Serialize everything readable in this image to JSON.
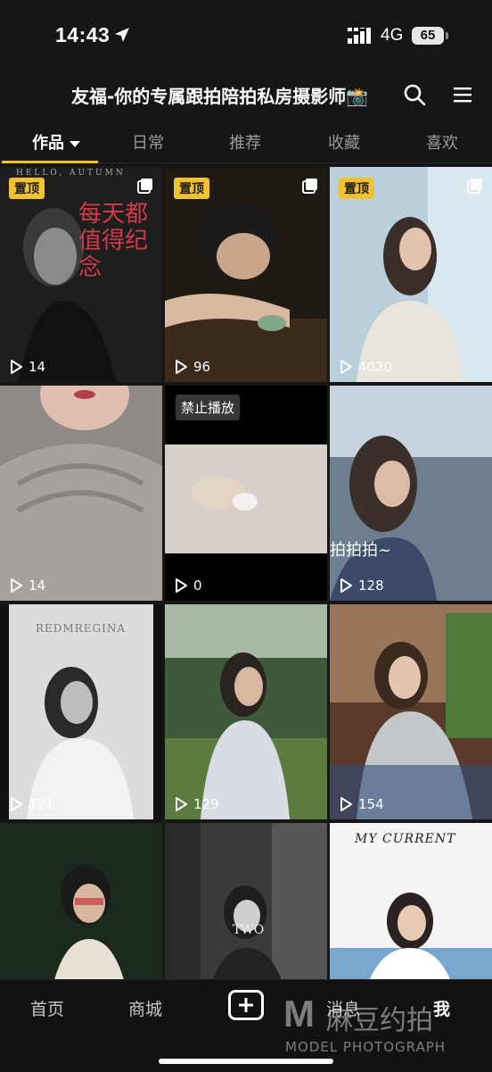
{
  "status_bar": {
    "time": "14:43",
    "network": "4G",
    "battery": "65"
  },
  "header": {
    "title": "友福-你的专属跟拍陪拍私房摄影师📸"
  },
  "tabs": [
    {
      "label": "作品"
    },
    {
      "label": "日常"
    },
    {
      "label": "推荐"
    },
    {
      "label": "收藏"
    },
    {
      "label": "喜欢"
    }
  ],
  "pin_label": "置顶",
  "banned_label": "禁止播放",
  "posts": [
    {
      "views": "14",
      "overlay": "每天都值得纪念",
      "caption": "HELLO, AUTUMN"
    },
    {
      "views": "96"
    },
    {
      "views": "4020"
    },
    {
      "views": "14"
    },
    {
      "views": "0"
    },
    {
      "views": "128",
      "overlay": "拍拍拍~"
    },
    {
      "views": "121",
      "caption": "REDMREGINA"
    },
    {
      "views": "129"
    },
    {
      "views": "154"
    },
    {
      "views": ""
    },
    {
      "views": "",
      "caption": "TWO"
    },
    {
      "views": "",
      "caption": "MY CURRENT"
    }
  ],
  "bottom_nav": [
    {
      "label": "首页"
    },
    {
      "label": "商城"
    },
    {
      "label": "消息"
    },
    {
      "label": "我"
    }
  ],
  "watermark": {
    "cn": "麻豆约拍",
    "en": "MODEL PHOTOGRAPH"
  },
  "colors": {
    "accent": "#f1c21b",
    "background": "#161616"
  }
}
